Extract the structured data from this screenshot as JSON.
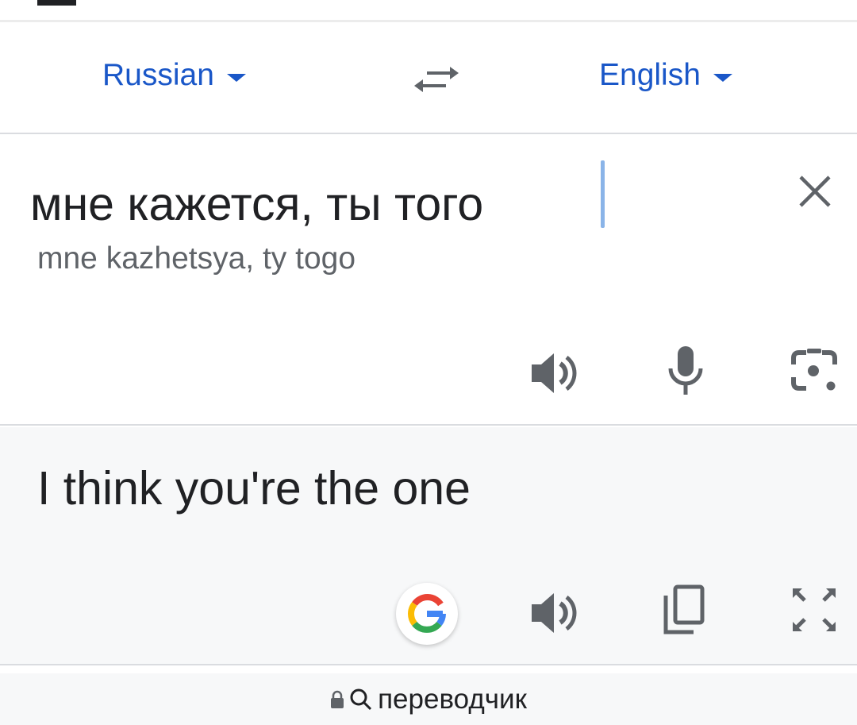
{
  "languages": {
    "source": "Russian",
    "target": "English"
  },
  "input": {
    "text": "мне кажется, ты того",
    "transliteration": "mne kazhetsya, ty togo"
  },
  "output": {
    "text": "I think you're the one"
  },
  "address_bar": {
    "query": "переводчик"
  },
  "icons": {
    "swap": "swap-icon",
    "clear": "close-icon",
    "listen": "speaker-icon",
    "mic": "microphone-icon",
    "camera": "camera-icon",
    "google": "google-logo-icon",
    "copy": "copy-icon",
    "fullscreen": "fullscreen-icon",
    "lock": "lock-icon",
    "search": "search-icon"
  },
  "colors": {
    "accent": "#1a57c8",
    "icon": "#5f6368",
    "output_bg": "#f7f8f9"
  }
}
